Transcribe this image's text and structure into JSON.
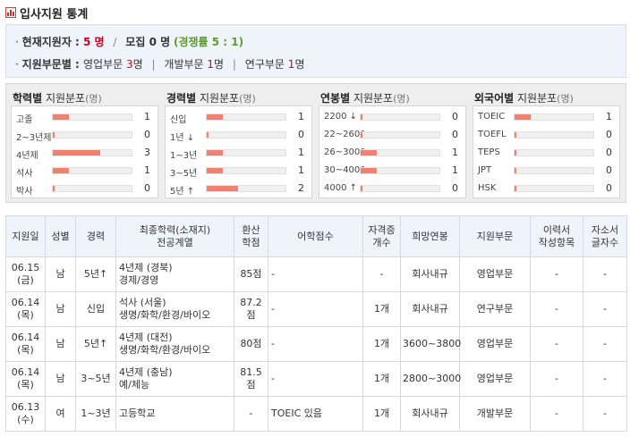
{
  "title": "입사지원 통계",
  "summary": {
    "line1": {
      "label": "현재지원자",
      "colon": " : ",
      "applicants": "5",
      "unit1": " 명",
      "slash": "/",
      "recruit_label": "모집",
      "recruit_value": " 0 명",
      "ratio": "(경쟁률 5 : 1)"
    },
    "line2": {
      "label": "지원부문별",
      "colon": " : ",
      "items": [
        {
          "name": "영업부문",
          "value": "3",
          "unit": "명"
        },
        {
          "name": "개발부문",
          "value": "1",
          "unit": "명"
        },
        {
          "name": "연구부문",
          "value": "1",
          "unit": "명"
        }
      ],
      "sep": "|"
    }
  },
  "distribution": [
    {
      "head_bold": "학력별",
      "head_rest": " 지원분포",
      "unit": "(명)",
      "rows": [
        {
          "label": "고졸",
          "value": 1
        },
        {
          "label": "2~3년제",
          "value": 0
        },
        {
          "label": "4년제",
          "value": 3
        },
        {
          "label": "석사",
          "value": 1
        },
        {
          "label": "박사",
          "value": 0
        }
      ]
    },
    {
      "head_bold": "경력별",
      "head_rest": " 지원분포",
      "unit": "(명)",
      "rows": [
        {
          "label": "신입",
          "value": 1
        },
        {
          "label": "1년 ↓",
          "value": 0
        },
        {
          "label": "1~3년",
          "value": 1
        },
        {
          "label": "3~5년",
          "value": 1
        },
        {
          "label": "5년 ↑",
          "value": 2
        }
      ]
    },
    {
      "head_bold": "연봉별",
      "head_rest": " 지원분포",
      "unit": "(명)",
      "rows": [
        {
          "label": "2200 ↓",
          "value": 0
        },
        {
          "label": "22~2600",
          "value": 0
        },
        {
          "label": "26~3000",
          "value": 1
        },
        {
          "label": "30~4000",
          "value": 1
        },
        {
          "label": "4000 ↑",
          "value": 0
        }
      ]
    },
    {
      "head_bold": "외국어별",
      "head_rest": " 지원분포",
      "unit": "(명)",
      "rows": [
        {
          "label": "TOEIC",
          "value": 1
        },
        {
          "label": "TOEFL",
          "value": 0
        },
        {
          "label": "TEPS",
          "value": 0
        },
        {
          "label": "JPT",
          "value": 0
        },
        {
          "label": "HSK",
          "value": 0
        }
      ]
    }
  ],
  "table": {
    "headers": [
      "지원일",
      "성별",
      "경력",
      "최종학력(소재지)\n전공계열",
      "환산\n학점",
      "어학점수",
      "자격증\n개수",
      "희망연봉",
      "지원부문",
      "이력서\n작성항목",
      "자소서\n글자수"
    ],
    "rows": [
      [
        "06.15\n(금)",
        "남",
        "5년↑",
        "4년제 (경북)\n경제/경영",
        "85점",
        "-",
        "-",
        "회사내규",
        "영업부문",
        "-",
        "-"
      ],
      [
        "06.14\n(목)",
        "남",
        "신입",
        "석사 (서울)\n생명/화학/환경/바이오",
        "87.2점",
        "-",
        "1개",
        "회사내규",
        "연구부문",
        "-",
        "-"
      ],
      [
        "06.14\n(목)",
        "남",
        "5년↑",
        "4년제 (대전)\n생명/화학/환경/바이오",
        "80점",
        "-",
        "1개",
        "3600~3800",
        "영업부문",
        "-",
        "-"
      ],
      [
        "06.14\n(목)",
        "남",
        "3~5년",
        "4년제 (충남)\n예/체능",
        "81.5점",
        "-",
        "1개",
        "2800~3000",
        "영업부문",
        "-",
        "-"
      ],
      [
        "06.13\n(수)",
        "여",
        "1~3년",
        "고등학교",
        "-",
        "TOEIC 있음",
        "1개",
        "회사내규",
        "개발부문",
        "-",
        "-"
      ]
    ]
  },
  "colors": {
    "bar": "#f08070",
    "accent_red": "#d0021b",
    "accent_green": "#5d9b2e",
    "header_bg": "#eef4fa"
  }
}
